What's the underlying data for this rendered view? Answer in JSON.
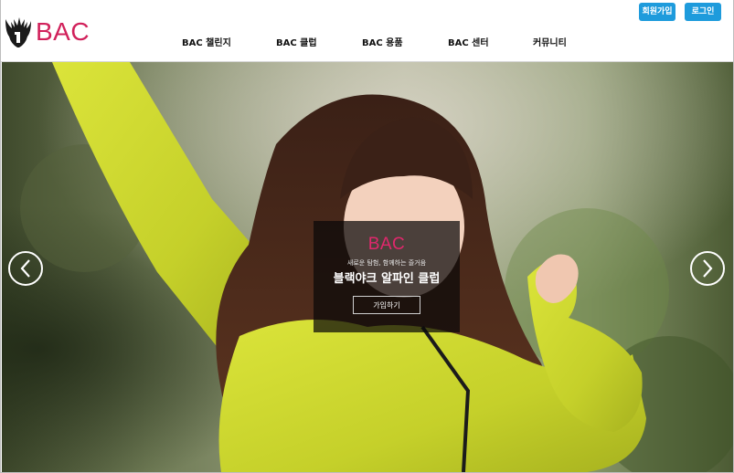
{
  "brand": {
    "logo_text": "BAC",
    "brand_color": "#d1215b"
  },
  "header": {
    "join_label": "회원가입",
    "login_label": "로그인",
    "button_color": "#1e9bdc"
  },
  "nav": {
    "items": [
      {
        "label": "BAC 챌린지"
      },
      {
        "label": "BAC 클럽"
      },
      {
        "label": "BAC 용품"
      },
      {
        "label": "BAC 센터"
      },
      {
        "label": "커뮤니티"
      }
    ]
  },
  "hero": {
    "icons": {
      "prev": "chevron-left-icon",
      "next": "chevron-right-icon"
    },
    "promo": {
      "logo": "BAC",
      "subtitle": "새로운 탐험, 함께하는 즐거움",
      "title": "블랙야크 알파인 클럽",
      "button_label": "가입하기"
    }
  }
}
